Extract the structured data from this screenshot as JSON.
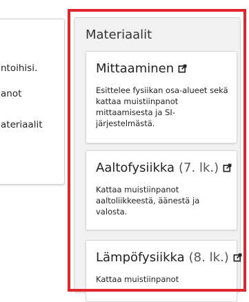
{
  "left_card": {
    "lines": [
      "ntoihisi.",
      "anot",
      "ateriaalit"
    ]
  },
  "materials": {
    "title": "Materiaalit",
    "cards": [
      {
        "title": "Mittaaminen",
        "grade": "",
        "description": "Esittelee fysiikan osa-alueet sekä kattaa muistiinpanot mittaamisesta ja SI-järjestelmästä."
      },
      {
        "title": "Aaltofysiikka",
        "grade": "(7. lk.)",
        "description": "Kattaa muistiinpanot aaltoliikkeestä, äänestä ja valosta."
      },
      {
        "title": "Lämpöfysiikka",
        "grade": "(8. lk.)",
        "description": "Kattaa muistiinpanot"
      }
    ]
  },
  "colors": {
    "highlight": "#e0262c",
    "panel_bg": "#f1f1f1"
  },
  "icons": {
    "external_link": "external-link-icon"
  }
}
